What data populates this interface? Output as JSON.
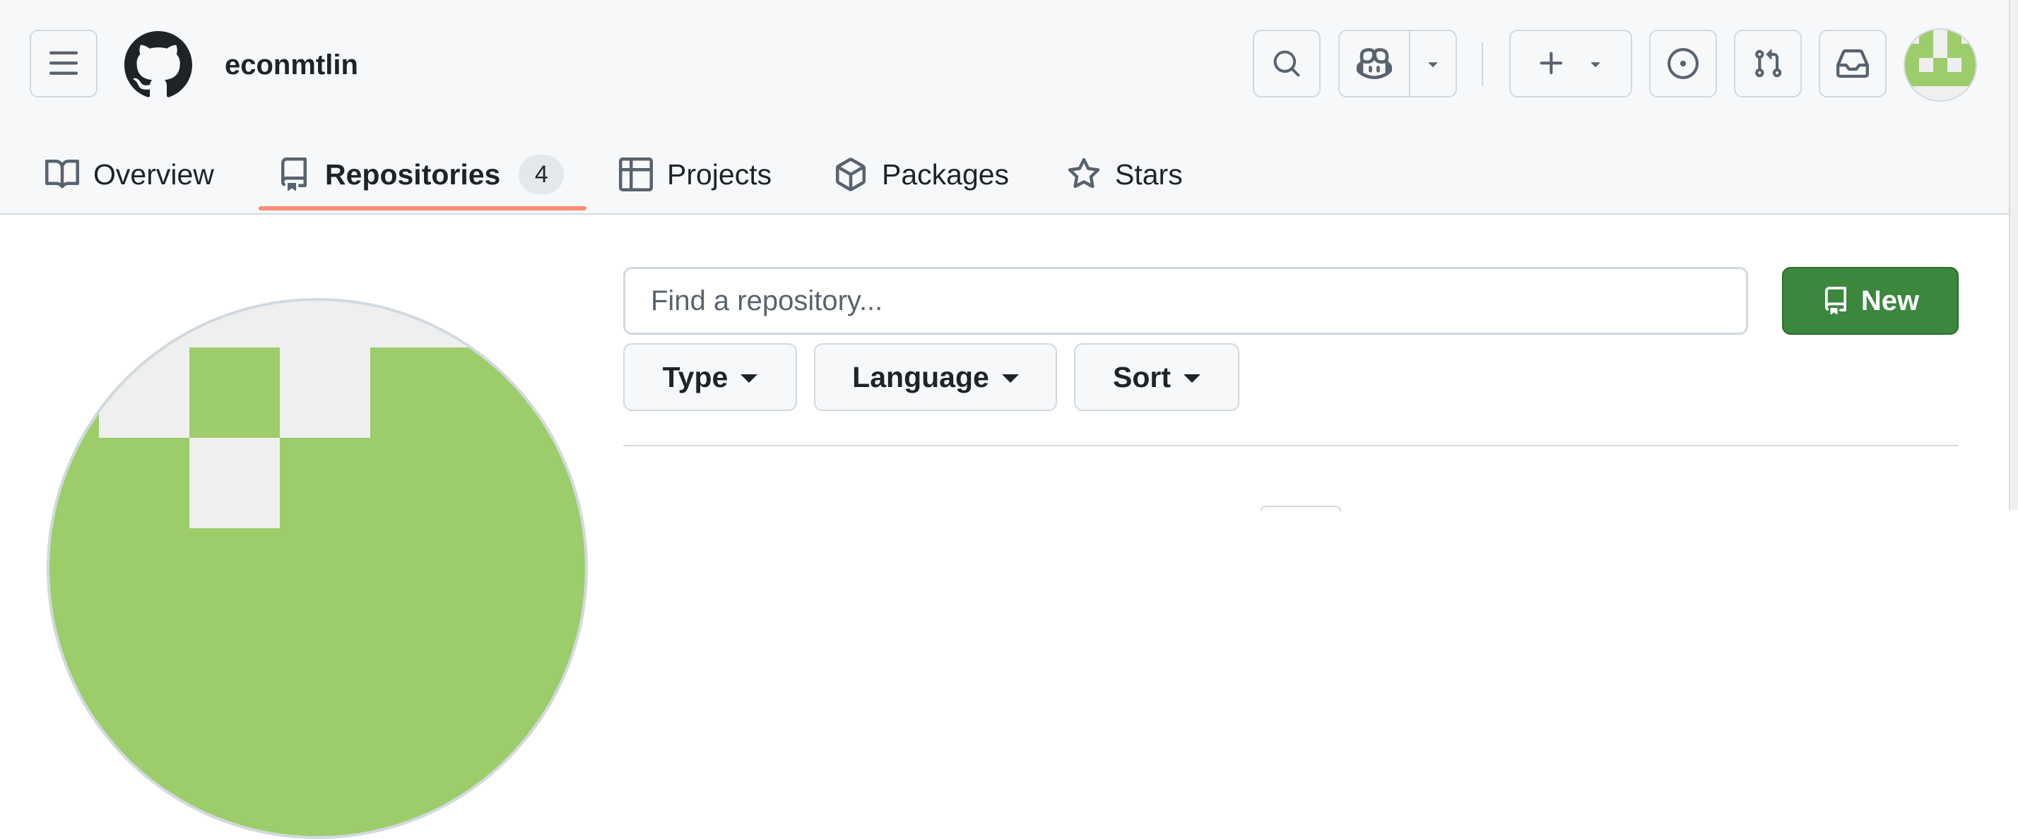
{
  "app": {
    "username": "econmtlin"
  },
  "header": {
    "icons": {
      "menu": "hamburger-icon",
      "logo": "github-logo-icon",
      "search": "search-icon",
      "copilot": "copilot-icon",
      "copilot_menu": "triangle-down-icon",
      "create": "plus-icon",
      "create_menu": "triangle-down-icon",
      "issues": "issue-opened-icon",
      "pulls": "git-pull-request-icon",
      "inbox": "inbox-icon"
    }
  },
  "tabs": [
    {
      "label": "Overview",
      "icon": "book-icon"
    },
    {
      "label": "Repositories",
      "icon": "repo-icon",
      "count": "4",
      "selected": true
    },
    {
      "label": "Projects",
      "icon": "table-icon"
    },
    {
      "label": "Packages",
      "icon": "package-icon"
    },
    {
      "label": "Stars",
      "icon": "star-icon"
    }
  ],
  "repo_filter": {
    "search_placeholder": "Find a repository...",
    "search_value": "",
    "new_label": "New",
    "type_label": "Type",
    "language_label": "Language",
    "sort_label": "Sort"
  },
  "colors": {
    "accent_underline": "#fd8c73",
    "primary_button": "#3b873e",
    "avatar_green": "#9dcc6a",
    "avatar_bg": "#efefef"
  }
}
